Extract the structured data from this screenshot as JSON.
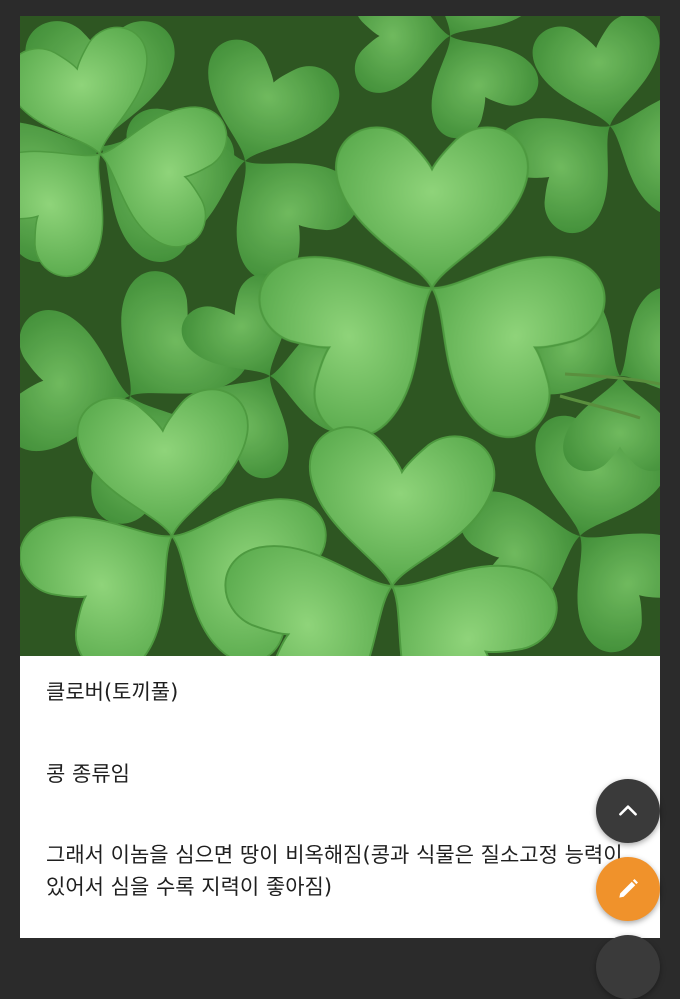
{
  "post": {
    "image_alt": "clover-leaves-photo",
    "lines": {
      "title": "클로버(토끼풀)",
      "line2": "콩 종류임",
      "line3": "그래서 이놈을 심으면 땅이 비옥해짐(콩과 식물은 질소고정 능력이 있어서 심을 수록 지력이 좋아짐)"
    }
  },
  "actions": {
    "scroll_top_icon": "chevron-up-icon",
    "write_icon": "pencil-icon"
  },
  "colors": {
    "accent": "#f0922b",
    "fab_dark": "#3a3a3a",
    "leaf_light": "#7fcb6a",
    "leaf_mid": "#5fb04d",
    "leaf_dark": "#3e8a33",
    "background": "#2b2b2b"
  }
}
